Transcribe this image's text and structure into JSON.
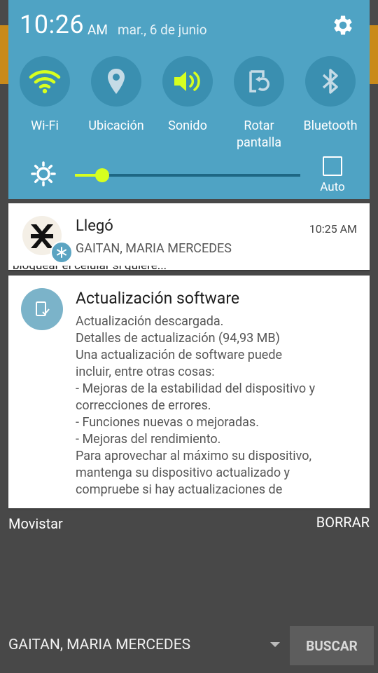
{
  "status": {
    "time": "10:26",
    "ampm": "AM",
    "date": "mar., 6 de junio"
  },
  "quick_settings": {
    "tiles": [
      {
        "label": "Wi-Fi",
        "icon": "wifi-icon",
        "active": true
      },
      {
        "label": "Ubicación",
        "icon": "location-icon",
        "active": false
      },
      {
        "label": "Sonido",
        "icon": "sound-icon",
        "active": true
      },
      {
        "label": "Rotar pantalla",
        "icon": "rotate-icon",
        "active": false
      },
      {
        "label": "Bluetooth",
        "icon": "bluetooth-icon",
        "active": false
      }
    ],
    "brightness_level": 0.12,
    "auto_label": "Auto",
    "accent_color": "#d7ff1f"
  },
  "notifications": [
    {
      "title": "Llegó",
      "time": "10:25 AM",
      "subtitle": "GAITAN, MARIA MERCEDES",
      "under_text": "bloquear el celular si quiere..."
    },
    {
      "title": "Actualización software",
      "body": [
        "Actualización descargada.",
        "Detalles de actualización (94,93 MB)",
        "Una actualización de software puede",
        "incluir, entre otras cosas:",
        " - Mejoras de la estabilidad del dispositivo y",
        "correcciones de errores.",
        " - Funciones nuevas o mejoradas.",
        " - Mejoras del rendimiento.",
        "Para aprovechar al máximo su dispositivo,",
        "mantenga su dispositivo actualizado y",
        "compruebe si hay actualizaciones de"
      ]
    }
  ],
  "footer": {
    "carrier": "Movistar",
    "clear_label": "BORRAR"
  },
  "app": {
    "selected_name": "GAITAN, MARIA MERCEDES",
    "search_label": "BUSCAR"
  }
}
